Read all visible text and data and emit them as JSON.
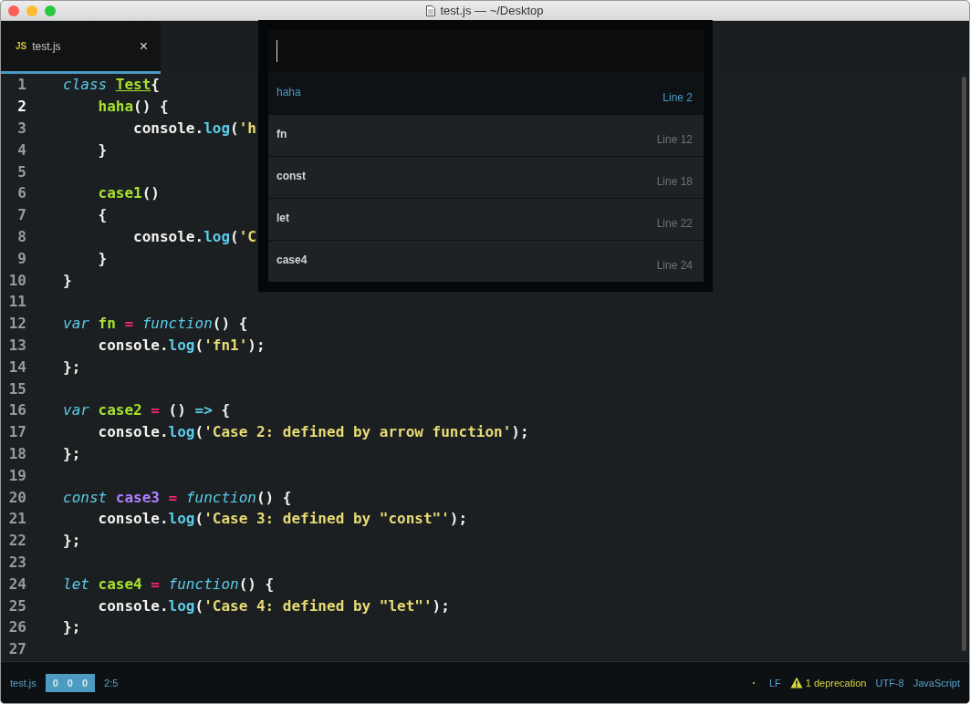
{
  "window": {
    "title": "test.js — ~/Desktop"
  },
  "tabs": [
    {
      "badge": "JS",
      "label": "test.js",
      "close": "×",
      "selected": true
    }
  ],
  "editor": {
    "lines": [
      {
        "number": "1",
        "current": false,
        "tokens": [
          {
            "kind": "kw",
            "t": "class "
          },
          {
            "kind": "cls",
            "t": "Test"
          },
          {
            "kind": "p",
            "t": "{"
          }
        ]
      },
      {
        "number": "2",
        "current": true,
        "tokens": [
          {
            "kind": "fn",
            "t": "    haha"
          },
          {
            "kind": "p",
            "t": "() {"
          }
        ]
      },
      {
        "number": "3",
        "current": false,
        "tokens": [
          {
            "kind": "p",
            "t": "        console."
          },
          {
            "kind": "call",
            "t": "log"
          },
          {
            "kind": "p",
            "t": "("
          },
          {
            "kind": "str",
            "t": "'h"
          }
        ]
      },
      {
        "number": "4",
        "current": false,
        "tokens": [
          {
            "kind": "p",
            "t": "    }"
          }
        ]
      },
      {
        "number": "5",
        "current": false
      },
      {
        "number": "6",
        "current": false,
        "tokens": [
          {
            "kind": "fn",
            "t": "    case1"
          },
          {
            "kind": "p",
            "t": "()"
          }
        ]
      },
      {
        "number": "7",
        "current": false,
        "tokens": [
          {
            "kind": "p",
            "t": "    {"
          }
        ]
      },
      {
        "number": "8",
        "current": false,
        "tokens": [
          {
            "kind": "p",
            "t": "        console."
          },
          {
            "kind": "call",
            "t": "log"
          },
          {
            "kind": "p",
            "t": "("
          },
          {
            "kind": "str",
            "t": "'C"
          }
        ]
      },
      {
        "number": "9",
        "current": false,
        "tokens": [
          {
            "kind": "p",
            "t": "    }"
          }
        ]
      },
      {
        "number": "10",
        "current": false,
        "tokens": [
          {
            "kind": "p",
            "t": "}"
          }
        ]
      },
      {
        "number": "11",
        "current": false
      },
      {
        "number": "12",
        "current": false,
        "tokens": [
          {
            "kind": "kw",
            "t": "var "
          },
          {
            "kind": "fn",
            "t": "fn "
          },
          {
            "kind": "op",
            "t": "= "
          },
          {
            "kind": "kw",
            "t": "function"
          },
          {
            "kind": "p",
            "t": "() {"
          }
        ]
      },
      {
        "number": "13",
        "current": false,
        "tokens": [
          {
            "kind": "p",
            "t": "    console."
          },
          {
            "kind": "call",
            "t": "log"
          },
          {
            "kind": "p",
            "t": "("
          },
          {
            "kind": "str",
            "t": "'fn1'"
          },
          {
            "kind": "p",
            "t": ");"
          }
        ]
      },
      {
        "number": "14",
        "current": false,
        "tokens": [
          {
            "kind": "p",
            "t": "};"
          }
        ]
      },
      {
        "number": "15",
        "current": false
      },
      {
        "number": "16",
        "current": false,
        "tokens": [
          {
            "kind": "kw",
            "t": "var "
          },
          {
            "kind": "fn",
            "t": "case2 "
          },
          {
            "kind": "op",
            "t": "= "
          },
          {
            "kind": "p",
            "t": "() "
          },
          {
            "kind": "call",
            "t": "=>"
          },
          {
            "kind": "p",
            "t": " {"
          }
        ]
      },
      {
        "number": "17",
        "current": false,
        "tokens": [
          {
            "kind": "p",
            "t": "    console."
          },
          {
            "kind": "call",
            "t": "log"
          },
          {
            "kind": "p",
            "t": "("
          },
          {
            "kind": "str",
            "t": "'Case 2: defined by arrow function'"
          },
          {
            "kind": "p",
            "t": ");"
          }
        ]
      },
      {
        "number": "18",
        "current": false,
        "tokens": [
          {
            "kind": "p",
            "t": "};"
          }
        ]
      },
      {
        "number": "19",
        "current": false
      },
      {
        "number": "20",
        "current": false,
        "tokens": [
          {
            "kind": "kw",
            "t": "const "
          },
          {
            "kind": "const",
            "t": "case3 "
          },
          {
            "kind": "op",
            "t": "= "
          },
          {
            "kind": "kw",
            "t": "function"
          },
          {
            "kind": "p",
            "t": "() {"
          }
        ]
      },
      {
        "number": "21",
        "current": false,
        "tokens": [
          {
            "kind": "p",
            "t": "    console."
          },
          {
            "kind": "call",
            "t": "log"
          },
          {
            "kind": "p",
            "t": "("
          },
          {
            "kind": "str",
            "t": "'Case 3: defined by \"const\"'"
          },
          {
            "kind": "p",
            "t": ");"
          }
        ]
      },
      {
        "number": "22",
        "current": false,
        "tokens": [
          {
            "kind": "p",
            "t": "};"
          }
        ]
      },
      {
        "number": "23",
        "current": false
      },
      {
        "number": "24",
        "current": false,
        "tokens": [
          {
            "kind": "kw",
            "t": "let "
          },
          {
            "kind": "fn",
            "t": "case4 "
          },
          {
            "kind": "op",
            "t": "= "
          },
          {
            "kind": "kw",
            "t": "function"
          },
          {
            "kind": "p",
            "t": "() {"
          }
        ]
      },
      {
        "number": "25",
        "current": false,
        "tokens": [
          {
            "kind": "p",
            "t": "    console."
          },
          {
            "kind": "call",
            "t": "log"
          },
          {
            "kind": "p",
            "t": "("
          },
          {
            "kind": "str",
            "t": "'Case 4: defined by \"let\"'"
          },
          {
            "kind": "p",
            "t": ");"
          }
        ]
      },
      {
        "number": "26",
        "current": false,
        "tokens": [
          {
            "kind": "p",
            "t": "};"
          }
        ]
      },
      {
        "number": "27",
        "current": false
      }
    ]
  },
  "symbol_list": {
    "items": [
      {
        "name": "haha",
        "line": "Line 2",
        "selected": true
      },
      {
        "name": "fn",
        "line": "Line 12",
        "selected": false
      },
      {
        "name": "const",
        "line": "Line 18",
        "selected": false
      },
      {
        "name": "let",
        "line": "Line 22",
        "selected": false
      },
      {
        "name": "case4",
        "line": "Line 24",
        "selected": false
      }
    ]
  },
  "status_bar": {
    "file": "test.js",
    "counts": [
      "0",
      "0",
      "0"
    ],
    "cursor": "2:5",
    "line_ending": "LF",
    "warning": "1 deprecation",
    "encoding": "UTF-8",
    "grammar": "JavaScript"
  }
}
